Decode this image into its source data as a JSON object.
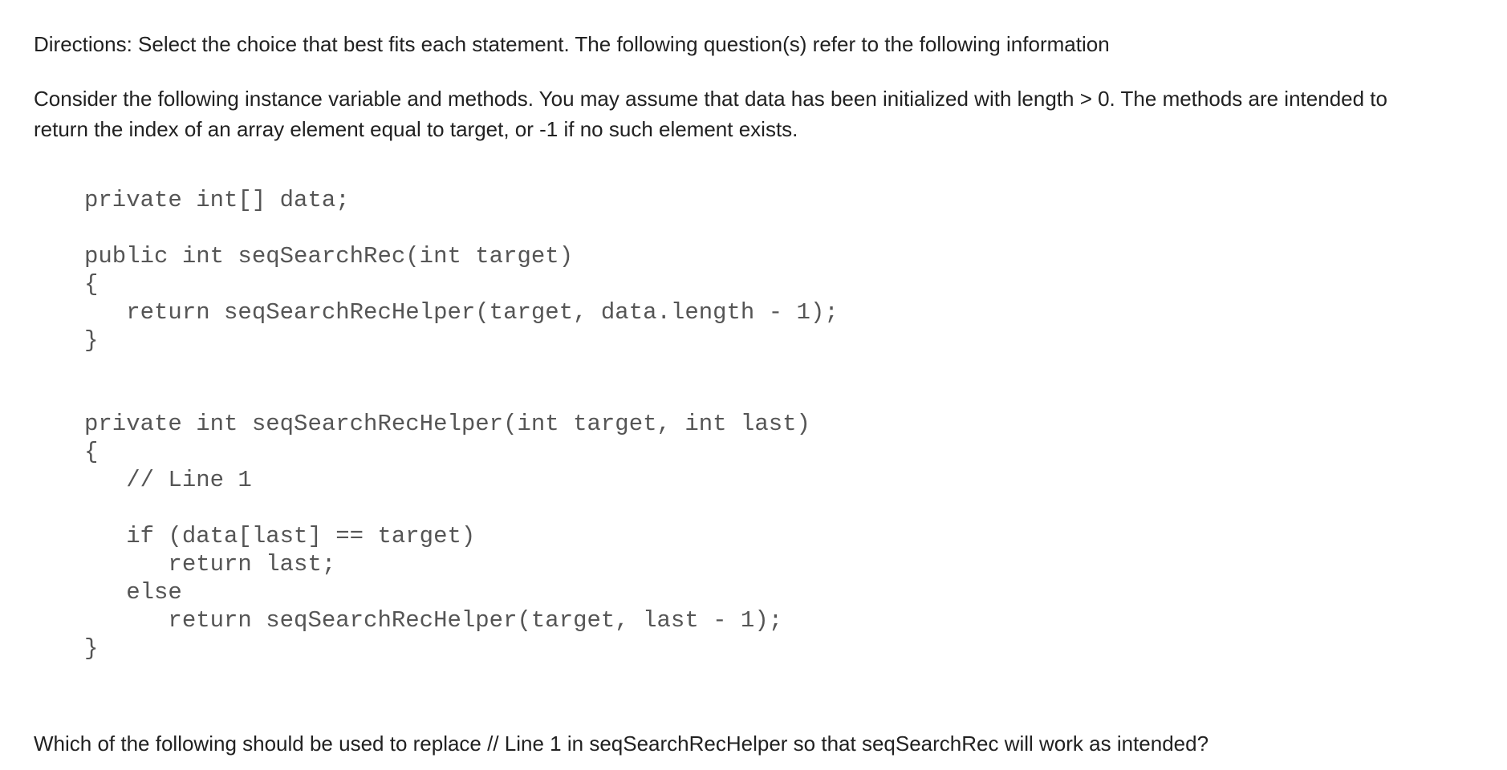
{
  "directions": "Directions: Select the choice that best fits each statement. The following question(s) refer to the following information",
  "intro": [
    "Consider the following instance variable and methods. You may assume that data has been initialized with length > 0. The methods are intended to",
    "return the index of an array element equal to target, or -1 if no such element exists."
  ],
  "code_lines": [
    "private int[] data;",
    "public int seqSearchRec(int target)",
    "{",
    "   return seqSearchRecHelper(target, data.length - 1);",
    "}",
    "private int seqSearchRecHelper(int target, int last)",
    "{",
    "   // Line 1",
    "   if (data[last] == target)",
    "      return last;",
    "   else",
    "      return seqSearchRecHelper(target, last - 1);",
    "}"
  ],
  "question": "Which of the following should be used to replace // Line 1 in seqSearchRecHelper so that seqSearchRec will work as intended?"
}
